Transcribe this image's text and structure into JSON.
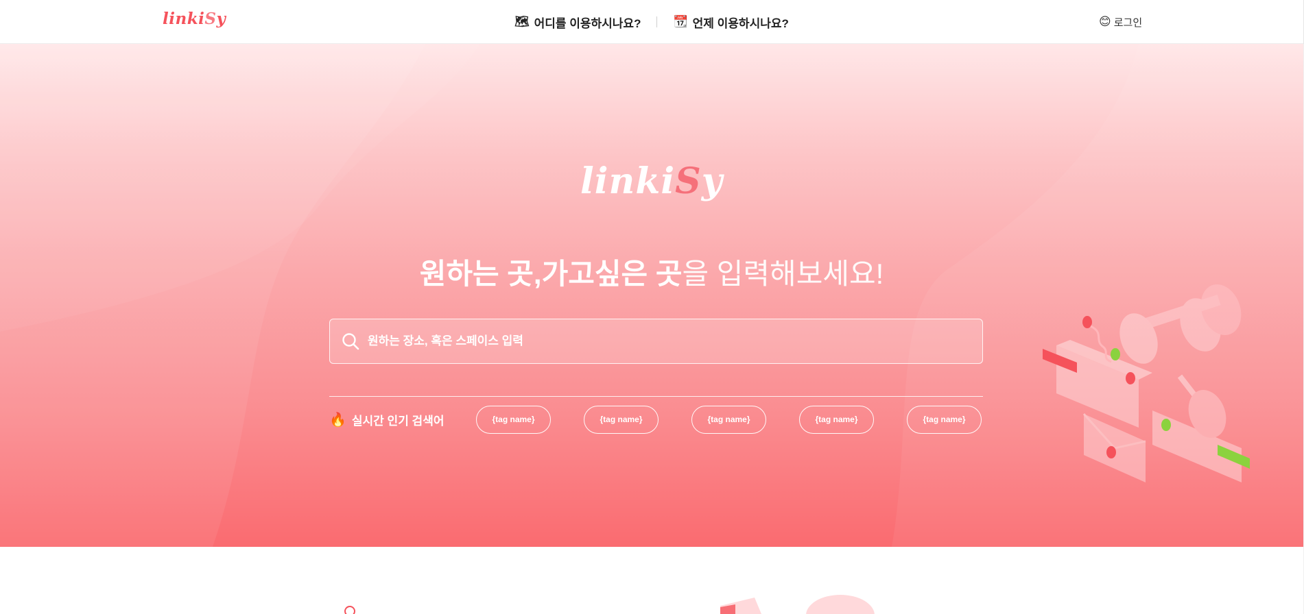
{
  "header": {
    "logo_main": "linki",
    "logo_s": "S",
    "logo_end": "y",
    "nav": [
      {
        "icon": "map-icon",
        "glyph": "🗺",
        "label": "어디를 이용하시나요?"
      },
      {
        "icon": "calendar-icon",
        "glyph": "📆",
        "label": "언제 이용하시나요?"
      }
    ],
    "login": {
      "icon": "smile-emoji-icon",
      "glyph": "😊",
      "label": "로그인"
    }
  },
  "hero": {
    "logo_main": "linki",
    "logo_s": "S",
    "logo_end": "y",
    "headline_bold": "원하는 곳,가고싶은 곳",
    "headline_light": "을 입력해보세요!",
    "search": {
      "placeholder": "원하는 장소, 혹은 스페이스 입력"
    },
    "trending": {
      "fire_glyph": "🔥",
      "label": "실시간 인기 검색어",
      "tags": [
        "{tag name}",
        "{tag name}",
        "{tag name}",
        "{tag name}",
        "{tag name}"
      ]
    }
  },
  "colors": {
    "brand": "#f5525b",
    "hero_top": "#ffe7e8",
    "hero_bottom": "#fa6b70",
    "accent_green": "#8bd23e"
  }
}
